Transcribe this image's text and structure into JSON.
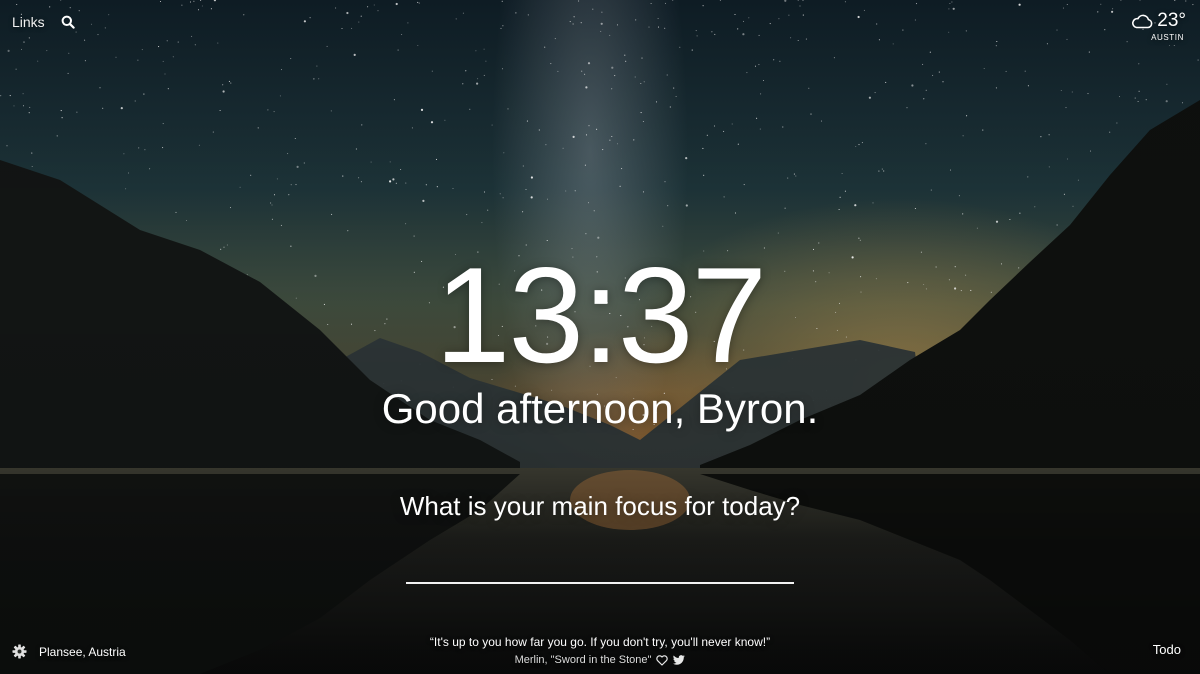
{
  "top_bar": {
    "links_label": "Links",
    "search_icon": "search-icon"
  },
  "weather": {
    "icon": "cloud-icon",
    "temperature": "23°",
    "city": "AUSTIN"
  },
  "main": {
    "time": "13:37",
    "greeting": "Good afternoon, Byron.",
    "focus_question": "What is your main focus for today?",
    "focus_value": ""
  },
  "footer": {
    "settings_icon": "gear-icon",
    "location": "Plansee, Austria",
    "quote_text": "“It's up to you how far you go. If you don't try, you'll never know!”",
    "quote_source": "Merlin, \"Sword in the Stone\"",
    "quote_icons": [
      "heart-icon",
      "twitter-icon"
    ],
    "todo_label": "Todo"
  }
}
